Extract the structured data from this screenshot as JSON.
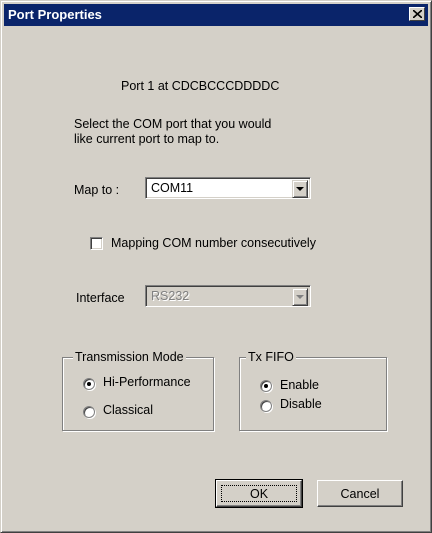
{
  "window": {
    "title": "Port Properties"
  },
  "port_info": "Port 1 at CDCBCCCDDDDC",
  "instructions": [
    "Select the COM port that you would",
    "like current port to map to."
  ],
  "map_to": {
    "label": "Map to :",
    "value": "COM11"
  },
  "mapping_checkbox": {
    "label": "Mapping COM number consecutively",
    "checked": false
  },
  "interface": {
    "label": "Interface",
    "value": "RS232",
    "enabled": false
  },
  "transmission_mode": {
    "title": "Transmission Mode",
    "options": [
      {
        "label": "Hi-Performance",
        "selected": true
      },
      {
        "label": "Classical",
        "selected": false
      }
    ]
  },
  "tx_fifo": {
    "title": "Tx FIFO",
    "options": [
      {
        "label": "Enable",
        "selected": true
      },
      {
        "label": "Disable",
        "selected": false
      }
    ]
  },
  "buttons": {
    "ok": "OK",
    "cancel": "Cancel"
  },
  "icons": {
    "close": "close-icon",
    "dropdown": "chevron-down-icon"
  },
  "colors": {
    "titlebar": "#0a246a",
    "dialog": "#d4d0c8"
  }
}
